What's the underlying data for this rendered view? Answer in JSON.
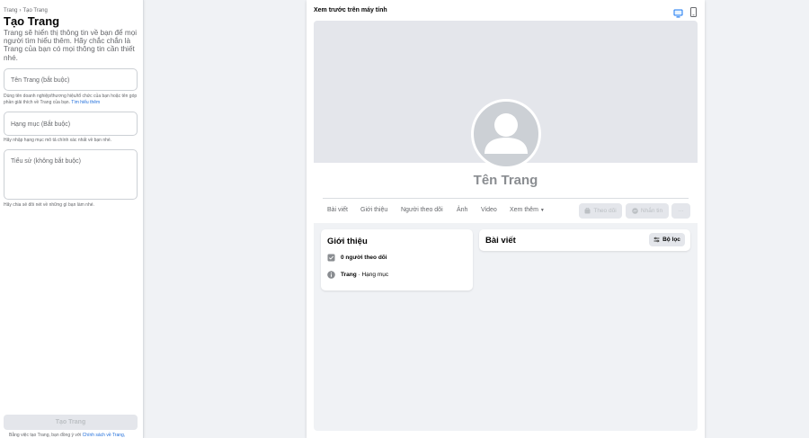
{
  "form": {
    "breadcrumb": [
      "Trang",
      "Tạo Trang"
    ],
    "breadcrumb_sep": "›",
    "title": "Tạo Trang",
    "description": "Trang sẽ hiển thị thông tin về bạn để mọi người tìm hiểu thêm. Hãy chắc chắn là Trang của bạn có mọi thông tin cần thiết nhé.",
    "name_placeholder": "Tên Trang (bắt buộc)",
    "name_hint": "Dùng tên doanh nghiệp/thương hiệu/tổ chức của bạn hoặc tên góp phần giải thích về Trang của bạn.",
    "name_hint_link": "Tìm hiểu thêm",
    "category_placeholder": "Hạng mục (Bắt buộc)",
    "category_hint": "Hãy nhập hạng mục mô tả chính xác nhất về bạn nhé.",
    "bio_placeholder": "Tiểu sử (không bắt buộc)",
    "bio_hint": "Hãy chia sẻ đôi nét về những gì bạn làm nhé.",
    "create_button": "Tạo Trang",
    "bottom_note": "Bằng việc tạo Trang, bạn đồng ý với",
    "bottom_note_link": "Chính sách về Trang,"
  },
  "preview": {
    "title": "Xem trước trên máy tính",
    "page_name": "Tên Trang",
    "tabs": [
      "Bài viết",
      "Giới thiệu",
      "Người theo dõi",
      "Ảnh",
      "Video",
      "Xem thêm"
    ],
    "follow_button": "Theo dõi",
    "message_button": "Nhắn tin",
    "more_button": "···",
    "intro_title": "Giới thiệu",
    "followers_text": "0 người theo dõi",
    "page_label": "Trang",
    "category_label": "· Hạng mục",
    "posts_title": "Bài viết",
    "filter_button": "Bộ lọc"
  },
  "colors": {
    "link": "#216fdb",
    "desktop_icon_active": "#1877f2"
  },
  "icons": {
    "desktop": "desktop-icon",
    "mobile": "mobile-icon"
  }
}
